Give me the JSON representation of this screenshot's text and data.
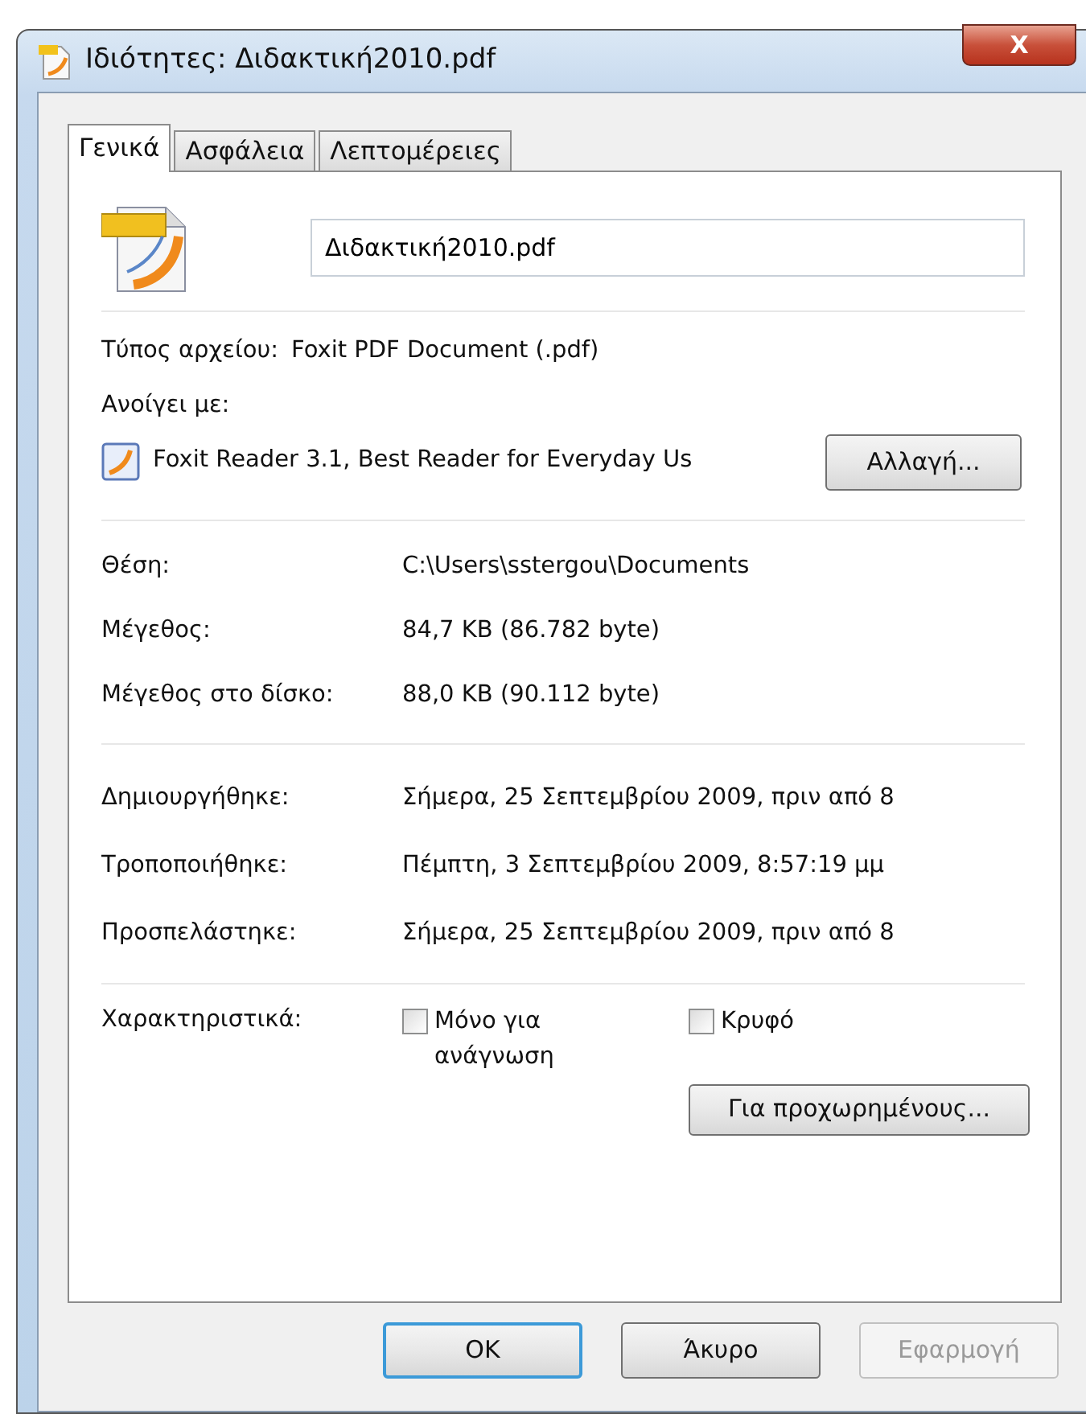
{
  "window": {
    "title": "Ιδιότητες: Διδακτική2010.pdf",
    "close": "X"
  },
  "tabs": [
    {
      "label": "Γενικά",
      "selected": true
    },
    {
      "label": "Ασφάλεια",
      "selected": false
    },
    {
      "label": "Λεπτομέρειες",
      "selected": false
    }
  ],
  "file_name": "Διδακτική2010.pdf",
  "file_type": {
    "label": "Τύπος αρχείου:",
    "value": "Foxit PDF Document (.pdf)"
  },
  "opens_with": {
    "label": "Ανοίγει με:",
    "app": "Foxit Reader 3.1, Best Reader for Everyday Us",
    "button": "Αλλαγή..."
  },
  "location_sizes": [
    {
      "label": "Θέση:",
      "value": "C:\\Users\\sstergou\\Documents"
    },
    {
      "label": "Μέγεθος:",
      "value": "84,7 KB (86.782 byte)"
    },
    {
      "label": "Μέγεθος στο δίσκο:",
      "value": "88,0 KB (90.112 byte)"
    }
  ],
  "dates": [
    {
      "label": "Δημιουργήθηκε:",
      "value": "Σήμερα, 25 Σεπτεμβρίου 2009, πριν από 8"
    },
    {
      "label": "Τροποποιήθηκε:",
      "value": "Πέμπτη, 3 Σεπτεμβρίου 2009, 8:57:19 μμ"
    },
    {
      "label": "Προσπελάστηκε:",
      "value": "Σήμερα, 25 Σεπτεμβρίου 2009, πριν από 8"
    }
  ],
  "attributes": {
    "label": "Χαρακτηριστικά:",
    "checkboxes": [
      {
        "label": "Μόνο για ανάγνωση",
        "checked": false
      },
      {
        "label": "Κρυφό",
        "checked": false
      }
    ],
    "advanced_button": "Για προχωρημένους..."
  },
  "buttons": [
    {
      "label": "OK",
      "default": true,
      "disabled": false
    },
    {
      "label": "Άκυρο",
      "default": false,
      "disabled": false
    },
    {
      "label": "Εφαρμογή",
      "default": false,
      "disabled": true
    }
  ]
}
